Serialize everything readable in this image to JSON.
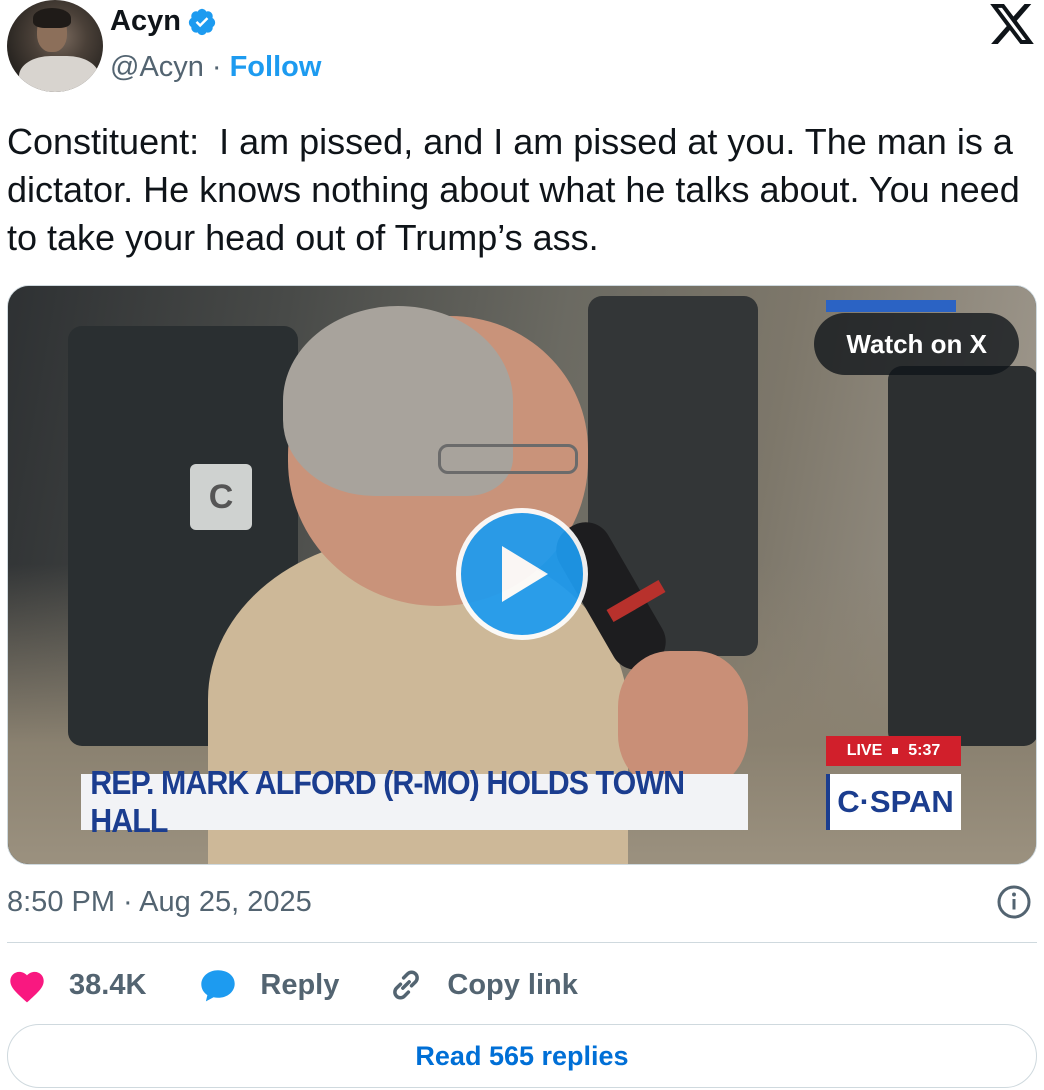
{
  "author": {
    "name": "Acyn",
    "handle": "@Acyn",
    "separator": "·",
    "follow_label": "Follow",
    "verified": true
  },
  "brand_icon": "x-logo-icon",
  "tweet": {
    "text": "Constituent:  I am pissed, and I am pissed at you. The man is a dictator. He knows nothing about what he talks about. You need to take your head out of Trump’s ass."
  },
  "media": {
    "watch_label": "Watch on X",
    "lower_third_text": "REP. MARK ALFORD (R-MO) HOLDS TOWN HALL",
    "network_label": "C·SPAN",
    "live_label": "LIVE",
    "live_time": "5:37",
    "seat_letter": "C"
  },
  "timestamp": "8:50 PM · Aug 25, 2025",
  "actions": {
    "like_count": "38.4K",
    "reply_label": "Reply",
    "copy_label": "Copy link"
  },
  "read_replies_label": "Read 565 replies",
  "colors": {
    "accent": "#1d9bf0",
    "like": "#f91880",
    "secondary_text": "#536471",
    "link": "#006fd6"
  }
}
